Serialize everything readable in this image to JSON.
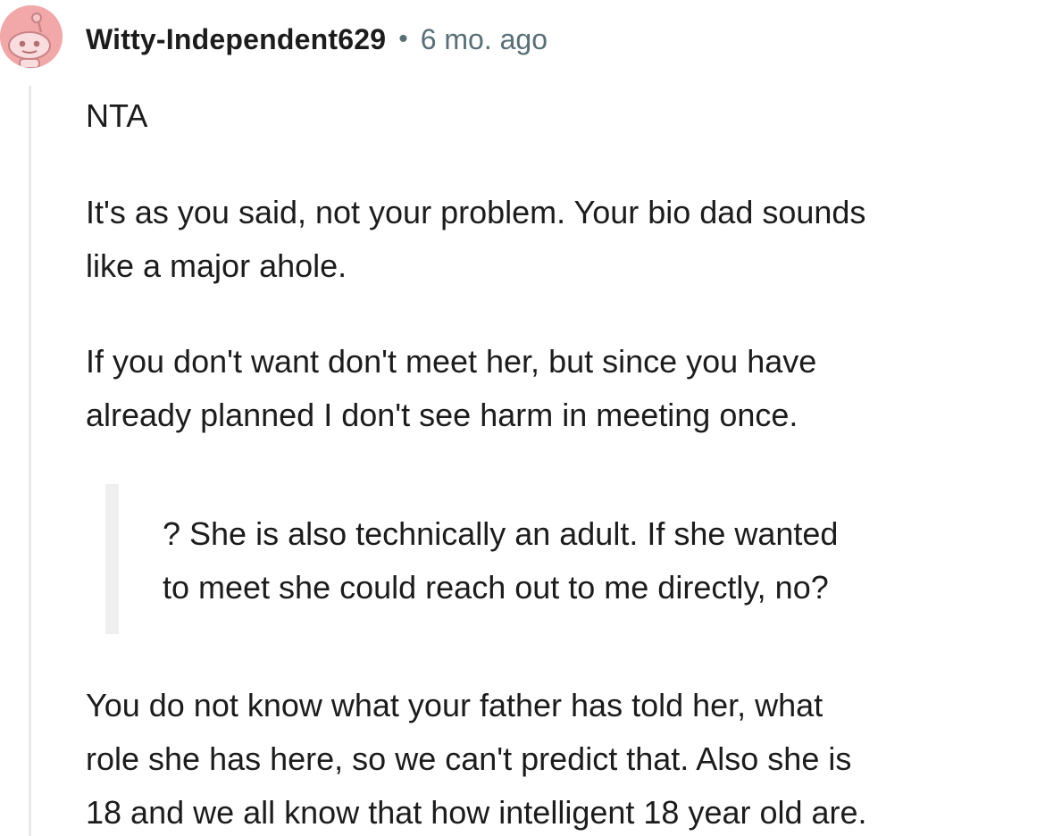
{
  "comment": {
    "author": {
      "username": "Witty-Independent629",
      "avatar_icon": "snoo-avatar-icon",
      "avatar_color": "#f2a7a9"
    },
    "separator": "•",
    "timestamp": "6 mo. ago",
    "body": {
      "p1": "NTA",
      "p2_line1": "It's as you said, not your problem. Your bio dad sounds",
      "p2_line2": "like a major ahole.",
      "p3_line1": "If you don't want don't meet her, but since you have",
      "p3_line2": "already planned I don't see harm in meeting once.",
      "quote_line1": "? She is also technically an adult. If she wanted",
      "quote_line2": "to meet she could reach out to me directly, no?",
      "p4_line1": "You do not know what your father has told her, what",
      "p4_line2": "role she has here, so we can't predict that. Also she is",
      "p4_line3": "18 and we all know that how intelligent 18 year old are."
    }
  },
  "colors": {
    "text": "#1c1c1c",
    "meta": "#576f76",
    "thread_line": "#e9e9e9",
    "quote_bar": "#efefef"
  }
}
